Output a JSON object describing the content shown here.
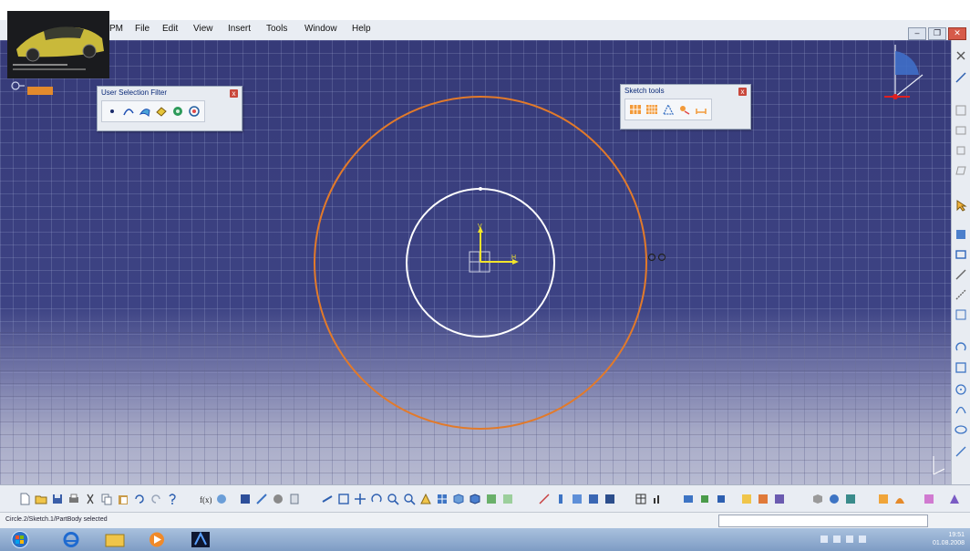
{
  "menu": {
    "items": [
      "PM",
      "File",
      "Edit",
      "View",
      "Insert",
      "Tools",
      "Window",
      "Help"
    ]
  },
  "toolbars": {
    "user_selection_filter": {
      "title": "User Selection Filter",
      "close": "x"
    },
    "sketch_tools": {
      "title": "Sketch tools",
      "close": "x"
    }
  },
  "axes": {
    "v_label": "V",
    "h_label": "H"
  },
  "status": {
    "message": "Circle.2/Sketch.1/PartBody selected"
  },
  "taskbar": {
    "time": "19:51",
    "date": "01.08.2008"
  },
  "colors": {
    "viewport_top": "#363a78",
    "outer_circle": "#e27a2a",
    "inner_circle": "#ffffff",
    "axis_yellow": "#f1e32b"
  }
}
